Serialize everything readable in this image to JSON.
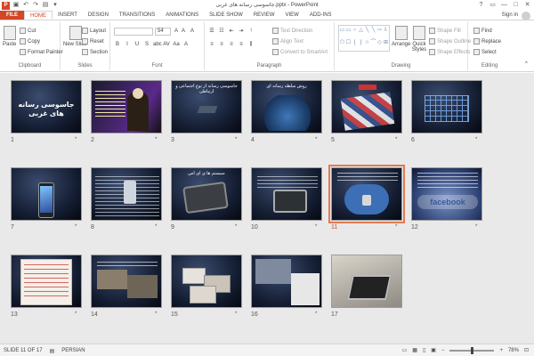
{
  "window": {
    "title": "جاسوسی رسانه های غربی.pptx - PowerPoint",
    "app_icon": "P",
    "qat": [
      "save-icon",
      "undo-icon",
      "redo-icon",
      "start-from-beginning-icon",
      "customize-qat-icon"
    ],
    "controls": [
      "?",
      "▭",
      "—",
      "□",
      "✕"
    ]
  },
  "tabs": {
    "file": "FILE",
    "items": [
      "HOME",
      "INSERT",
      "DESIGN",
      "TRANSITIONS",
      "ANIMATIONS",
      "SLIDE SHOW",
      "REVIEW",
      "VIEW",
      "ADD-INS"
    ],
    "active": "HOME",
    "signin": "Sign in"
  },
  "ribbon": {
    "clipboard": {
      "label": "Clipboard",
      "paste": "Paste",
      "cut": "Cut",
      "copy": "Copy",
      "format_painter": "Format Painter"
    },
    "slides": {
      "label": "Slides",
      "new_slide": "New Slide",
      "layout": "Layout",
      "reset": "Reset",
      "section": "Section"
    },
    "font": {
      "label": "Font",
      "size": "54",
      "grow": "A",
      "shrink": "A",
      "clear": "A",
      "format_row": [
        "B",
        "I",
        "U",
        "S",
        "abc",
        "AV",
        "Aa",
        "A"
      ]
    },
    "paragraph": {
      "label": "Paragraph",
      "text_direction": "Text Direction",
      "align_text": "Align Text",
      "convert_smartart": "Convert to SmartArt"
    },
    "drawing": {
      "label": "Drawing",
      "arrange": "Arrange",
      "quick_styles": "Quick Styles",
      "shape_fill": "Shape Fill",
      "shape_outline": "Shape Outline",
      "shape_effects": "Shape Effects",
      "shapes": [
        "▭",
        "▭",
        "○",
        "△",
        "╲",
        "╲",
        "⇨",
        "⇩",
        "⬠",
        "☐",
        "{",
        "}",
        "☆",
        "⌒",
        "◇",
        "⊞"
      ]
    },
    "editing": {
      "label": "Editing",
      "find": "Find",
      "replace": "Replace",
      "select": "Select"
    }
  },
  "slides": [
    {
      "num": "1",
      "title": "جاسوسی رسانه های غربی"
    },
    {
      "num": "2",
      "title": ""
    },
    {
      "num": "3",
      "title": "جاسوسی رسانه از نوع اجتماعی و ارتباطی"
    },
    {
      "num": "4",
      "title": "روش سلطه رسانه ای"
    },
    {
      "num": "5",
      "title": ""
    },
    {
      "num": "6",
      "title": ""
    },
    {
      "num": "7",
      "title": ""
    },
    {
      "num": "8",
      "title": ""
    },
    {
      "num": "9",
      "title": "سیستم ها ی ای اس"
    },
    {
      "num": "10",
      "title": ""
    },
    {
      "num": "11",
      "title": ""
    },
    {
      "num": "12",
      "title": ""
    },
    {
      "num": "13",
      "title": ""
    },
    {
      "num": "14",
      "title": ""
    },
    {
      "num": "15",
      "title": ""
    },
    {
      "num": "16",
      "title": ""
    },
    {
      "num": "17",
      "title": ""
    }
  ],
  "slide12_logo": "facebook",
  "slide_star": "*",
  "selected_slide": "11",
  "status": {
    "slide_info": "SLIDE 11 OF 17",
    "language": "PERSIAN",
    "zoom": "78%",
    "zoom_minus": "−",
    "zoom_plus": "+"
  }
}
